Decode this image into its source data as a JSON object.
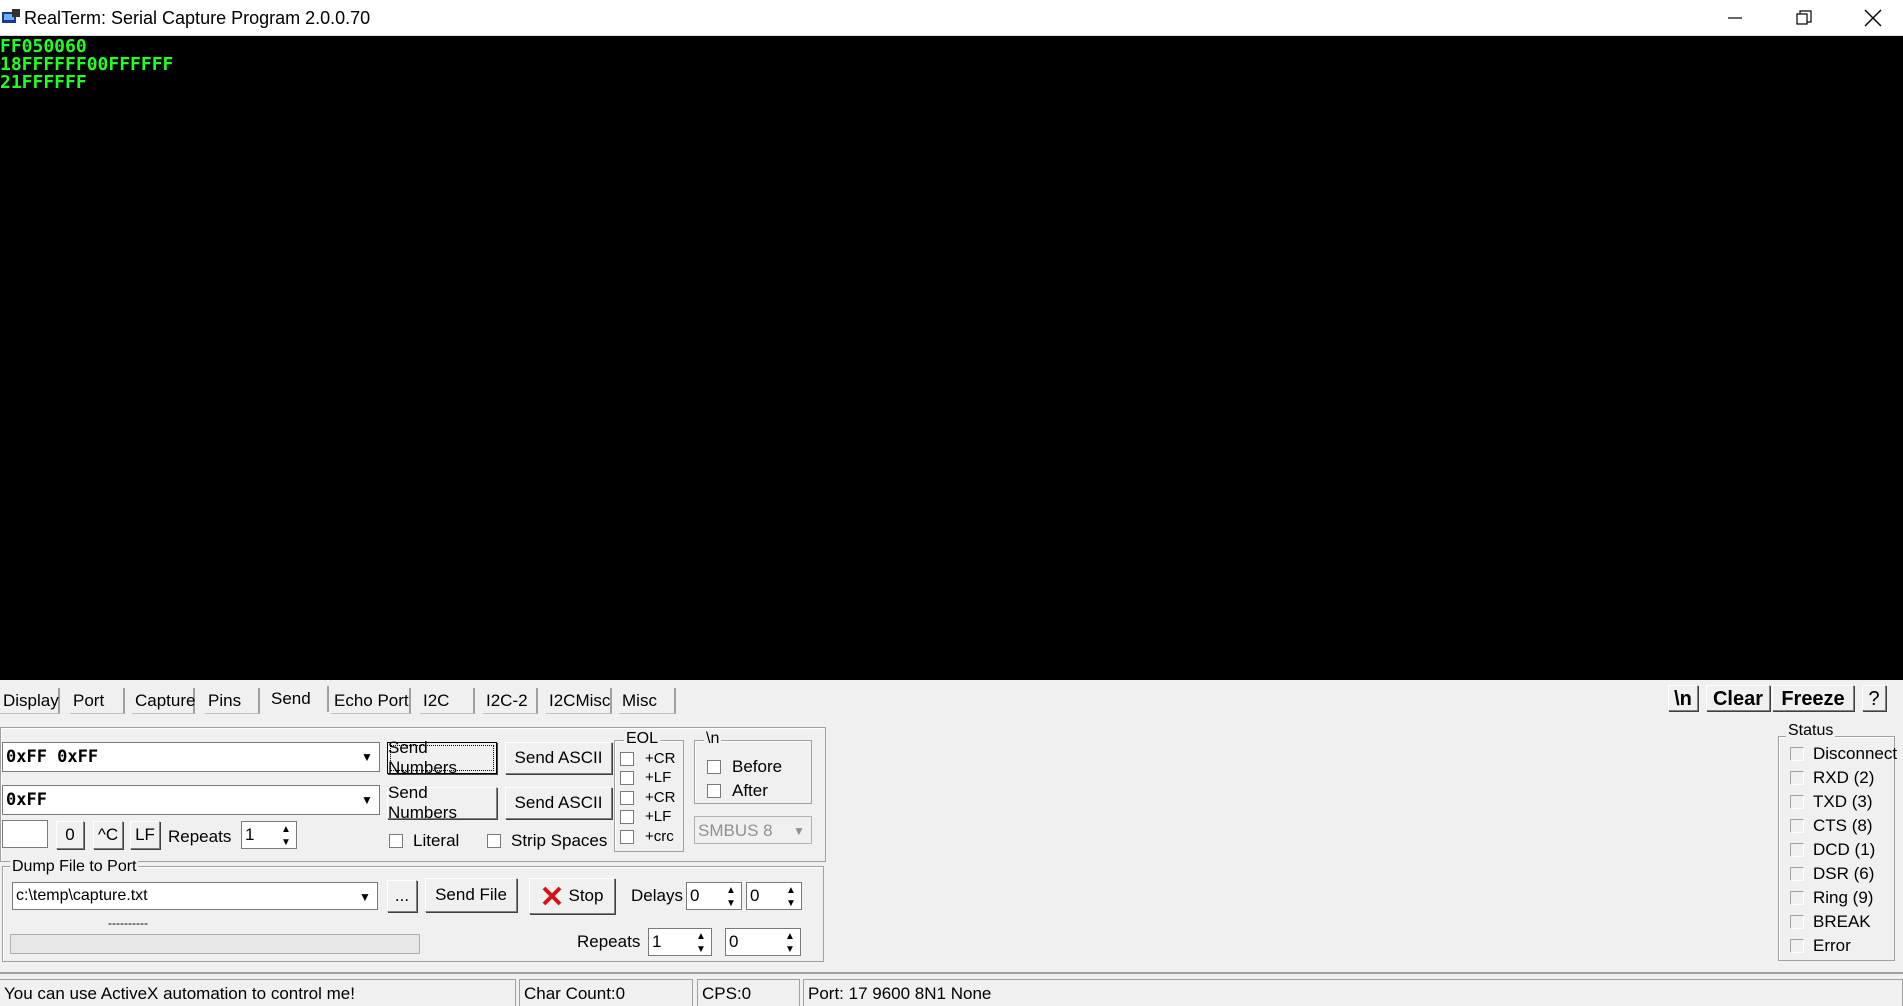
{
  "window": {
    "title": "RealTerm: Serial Capture Program 2.0.0.70",
    "controls": [
      "minimize-icon",
      "restore-icon",
      "close-icon"
    ]
  },
  "terminal": {
    "lines": [
      "FF050060",
      "18FFFFFF00FFFFFF",
      "21FFFFFF"
    ],
    "text_color": "#22ff22",
    "background": "#000000"
  },
  "tabs": [
    "Display",
    "Port",
    "Capture",
    "Pins",
    "Send",
    "Echo Port",
    "I2C",
    "I2C-2",
    "I2CMisc",
    "Misc"
  ],
  "active_tab": "Send",
  "toolbar": {
    "newline_label": "\\n",
    "clear_label": "Clear",
    "freeze_label": "Freeze",
    "help_label": "?"
  },
  "send": {
    "input1_value": "0xFF 0xFF",
    "input2_value": "0xFF",
    "send_numbers_label": "Send Numbers",
    "send_ascii_label": "Send ASCII",
    "small_input_value": "",
    "zero_label": "0",
    "ctrlc_label": "^C",
    "lf_label": "LF",
    "repeats_label": "Repeats",
    "repeats_value": "1",
    "literal_label": "Literal",
    "strip_spaces_label": "Strip Spaces",
    "eol_title": "EOL",
    "eol_options": [
      "+CR",
      "+LF",
      "+CR",
      "+LF",
      "+crc"
    ],
    "nl_title": "\\n",
    "before_label": "Before",
    "after_label": "After",
    "smbus_value": "SMBUS 8"
  },
  "dump": {
    "title": "Dump File to Port",
    "file_value": "c:\\temp\\capture.txt",
    "browse_label": "...",
    "send_file_label": "Send File",
    "stop_label": "Stop",
    "delays_label": "Delays",
    "delay1_value": "0",
    "delay2_value": "0",
    "progress_text": "----------",
    "repeats_label": "Repeats",
    "repeats1_value": "1",
    "repeats2_value": "0"
  },
  "status_panel": {
    "title": "Status",
    "items": [
      "Disconnect",
      "RXD (2)",
      "TXD (3)",
      "CTS (8)",
      "DCD (1)",
      "DSR (6)",
      "Ring (9)",
      "BREAK",
      "Error"
    ]
  },
  "statusbar": {
    "message": "You can use ActiveX automation to control me!",
    "char_count": "Char Count:0",
    "cps": "CPS:0",
    "port": "Port: 17 9600 8N1 None"
  }
}
